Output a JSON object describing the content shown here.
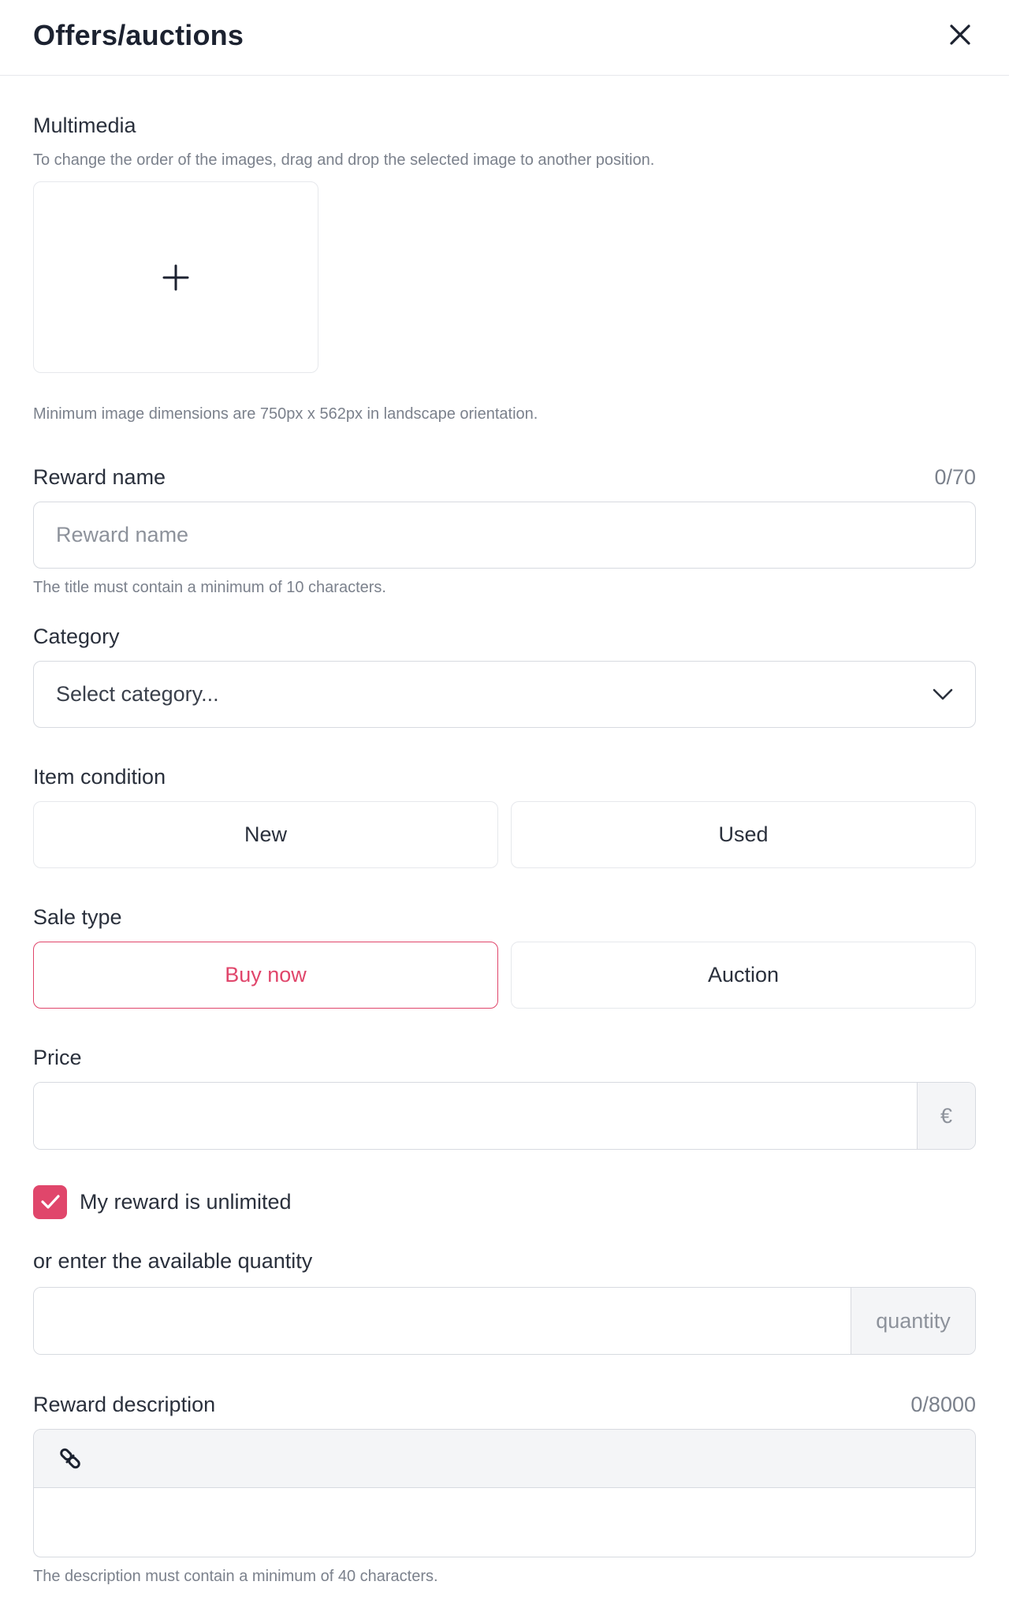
{
  "header": {
    "title": "Offers/auctions"
  },
  "multimedia": {
    "label": "Multimedia",
    "hint": "To change the order of the images, drag and drop the selected image to another position.",
    "dimensions_hint": "Minimum image dimensions are 750px x 562px in landscape orientation."
  },
  "reward_name": {
    "label": "Reward name",
    "counter": "0/70",
    "placeholder": "Reward name",
    "value": "",
    "hint": "The title must contain a minimum of 10 characters."
  },
  "category": {
    "label": "Category",
    "selected": "Select category..."
  },
  "item_condition": {
    "label": "Item condition",
    "options": [
      "New",
      "Used"
    ]
  },
  "sale_type": {
    "label": "Sale type",
    "options": [
      "Buy now",
      "Auction"
    ],
    "selected": "Buy now"
  },
  "price": {
    "label": "Price",
    "value": "",
    "currency": "€"
  },
  "unlimited": {
    "label": "My reward is unlimited",
    "checked": true
  },
  "quantity": {
    "label": "or enter the available quantity",
    "value": "",
    "addon": "quantity"
  },
  "description": {
    "label": "Reward description",
    "counter": "0/8000",
    "hint": "The description must contain a minimum of 40 characters."
  },
  "icons": {
    "close": "close-icon",
    "add": "plus-icon",
    "dropdown": "chevron-down-icon",
    "check": "check-icon",
    "link": "link-icon"
  },
  "colors": {
    "accent": "#e0466b",
    "border": "#d7dae0",
    "muted_text": "#7b818c"
  }
}
